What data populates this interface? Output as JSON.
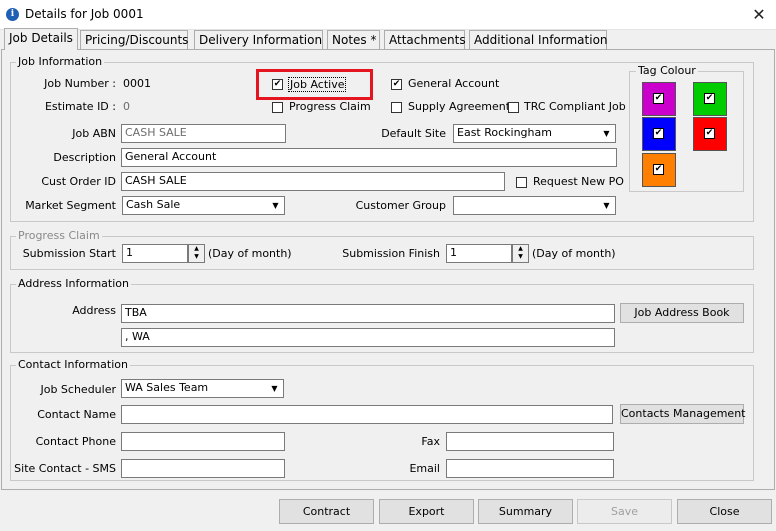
{
  "window": {
    "title": "Details for Job 0001",
    "icon_letter": "i",
    "close_glyph": "✕"
  },
  "tabs": [
    {
      "label": "Job Details"
    },
    {
      "label": "Pricing/Discounts"
    },
    {
      "label": "Delivery Information"
    },
    {
      "label": "Notes *"
    },
    {
      "label": "Attachments"
    },
    {
      "label": "Additional Information"
    }
  ],
  "job_info": {
    "title": "Job Information",
    "job_number_label": "Job Number :",
    "job_number_value": "0001",
    "estimate_id_label": "Estimate ID :",
    "estimate_id_value": "0",
    "job_active_label": "Job Active",
    "job_active_checked": true,
    "progress_claim_label": "Progress Claim",
    "progress_claim_checked": false,
    "general_account_label": "General Account",
    "general_account_checked": true,
    "supply_agreement_label": "Supply Agreement",
    "supply_agreement_checked": false,
    "trc_label": "TRC Compliant Job",
    "trc_checked": false,
    "job_abn_label": "Job ABN",
    "job_abn_value": "CASH SALE",
    "default_site_label": "Default Site",
    "default_site_value": "East Rockingham",
    "description_label": "Description",
    "description_value": "General Account",
    "cust_order_label": "Cust Order ID",
    "cust_order_value": "CASH SALE",
    "request_new_po_label": "Request New PO",
    "request_new_po_checked": false,
    "market_segment_label": "Market Segment",
    "market_segment_value": "Cash Sale",
    "customer_group_label": "Customer Group",
    "customer_group_value": ""
  },
  "tag_colour": {
    "title": "Tag Colour",
    "tags": [
      {
        "color": "#cc00cc",
        "checked": true
      },
      {
        "color": "#00cc00",
        "checked": true
      },
      {
        "color": "#0000ff",
        "checked": true
      },
      {
        "color": "#ff0000",
        "checked": true
      },
      {
        "color": "#ff8000",
        "checked": true
      }
    ]
  },
  "progress_claim": {
    "title": "Progress Claim",
    "start_label": "Submission Start",
    "start_value": "1",
    "start_suffix": "(Day of month)",
    "finish_label": "Submission Finish",
    "finish_value": "1",
    "finish_suffix": "(Day of month)"
  },
  "address": {
    "title": "Address Information",
    "address_label": "Address",
    "line1": "TBA",
    "line2": ", WA",
    "address_book_button": "Job Address Book"
  },
  "contact": {
    "title": "Contact Information",
    "scheduler_label": "Job Scheduler",
    "scheduler_value": "WA Sales Team",
    "contact_name_label": "Contact Name",
    "contact_name_value": "",
    "contacts_mgmt_button": "Contacts Management",
    "phone_label": "Contact Phone",
    "phone_value": "",
    "fax_label": "Fax",
    "fax_value": "",
    "sms_label": "Site Contact - SMS",
    "sms_value": "",
    "email_label": "Email",
    "email_value": ""
  },
  "buttons": {
    "contract": "Contract",
    "export": "Export",
    "summary": "Summary",
    "save": "Save",
    "close": "Close"
  },
  "check_glyph": "✔",
  "arrow_down": "▼",
  "arrow_up": "▲"
}
